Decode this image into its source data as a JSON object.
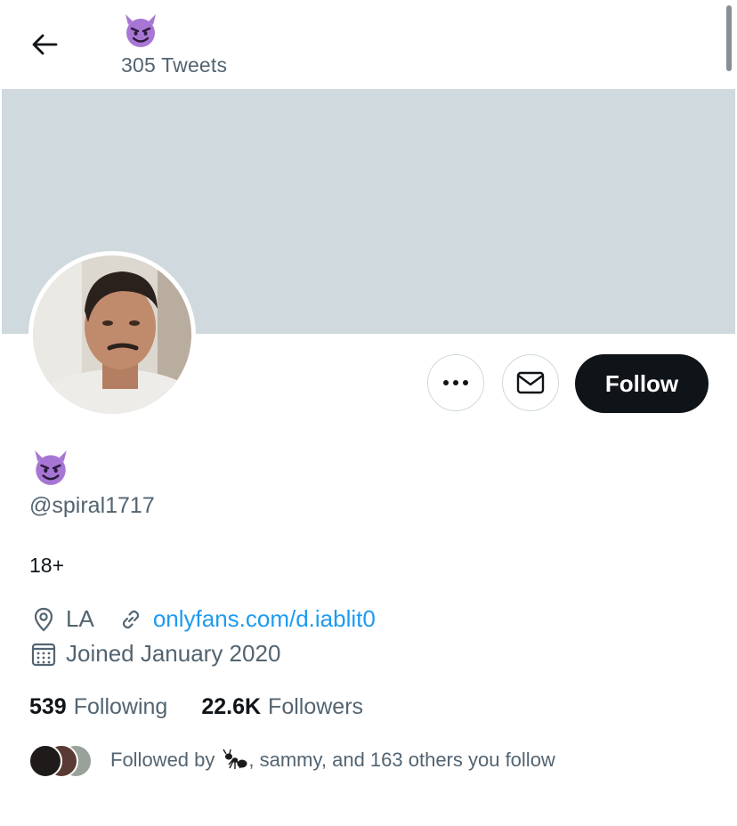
{
  "header": {
    "back_icon": "arrow-left-icon",
    "display_emoji": "smiling-devil-emoji",
    "tweet_count": "305 Tweets"
  },
  "profile": {
    "name_emoji": "smiling-devil-emoji",
    "handle": "@spiral1717",
    "bio": "18+",
    "location": "LA",
    "url": "onlyfans.com/d.iablit0",
    "joined": "Joined January 2020",
    "following_count": "539",
    "following_label": "Following",
    "followers_count": "22.6K",
    "followers_label": "Followers"
  },
  "actions": {
    "more_icon": "more-horizontal-icon",
    "message_icon": "envelope-icon",
    "follow_label": "Follow"
  },
  "followed_by": {
    "prefix": "Followed by",
    "suffix": ", sammy, and 163 others you follow"
  },
  "colors": {
    "banner": "#cfd9de",
    "link": "#1d9bf0",
    "secondary_text": "#536471",
    "follow_button": "#0f1419",
    "emoji_purple": "#a776d4"
  }
}
